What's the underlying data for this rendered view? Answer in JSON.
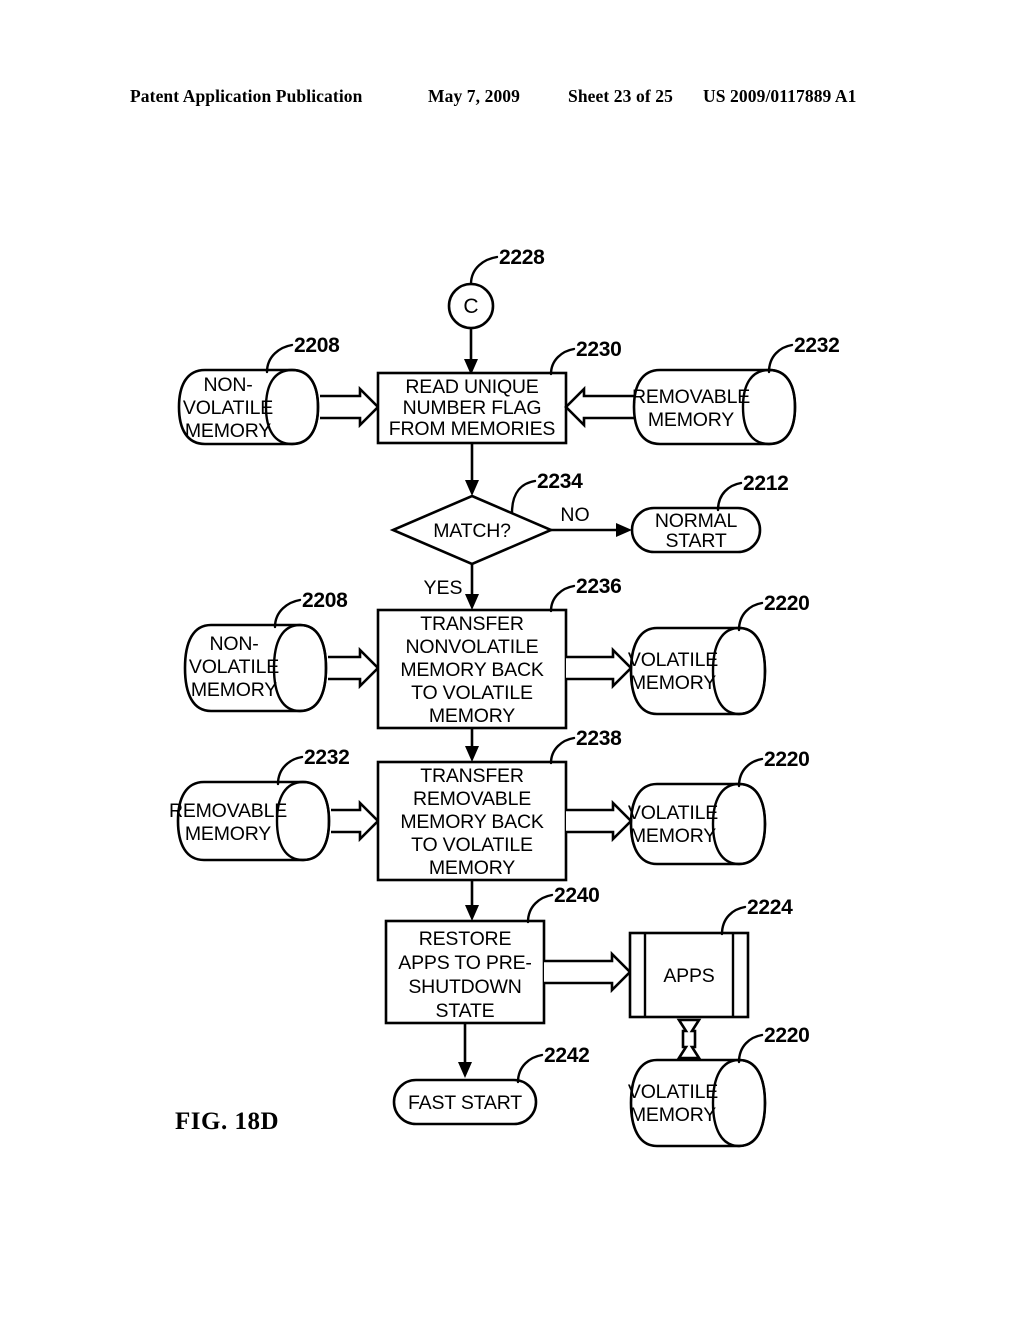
{
  "header": {
    "publication": "Patent Application Publication",
    "date": "May 7, 2009",
    "sheet": "Sheet 23 of 25",
    "patent_number": "US 2009/0117889 A1"
  },
  "figure": {
    "label": "FIG. 18D",
    "connector": {
      "letter": "C",
      "ref": "2228"
    },
    "nodes": {
      "nonvolatile_memory_top": {
        "type": "cylinder",
        "lines": [
          "NON-",
          "VOLATILE",
          "MEMORY"
        ],
        "ref": "2208"
      },
      "read_unique_number_flag": {
        "type": "process",
        "lines": [
          "READ UNIQUE",
          "NUMBER FLAG",
          "FROM MEMORIES"
        ],
        "ref": "2230"
      },
      "removable_memory_top": {
        "type": "cylinder",
        "lines": [
          "REMOVABLE",
          "MEMORY"
        ],
        "ref": "2232"
      },
      "match_decision": {
        "type": "decision",
        "lines": [
          "MATCH?"
        ],
        "ref": "2234",
        "branch_no": "NO",
        "branch_yes": "YES"
      },
      "normal_start": {
        "type": "terminator",
        "lines": [
          "NORMAL",
          "START"
        ],
        "ref": "2212"
      },
      "nonvolatile_memory_mid": {
        "type": "cylinder",
        "lines": [
          "NON-",
          "VOLATILE",
          "MEMORY"
        ],
        "ref": "2208"
      },
      "transfer_nonvolatile": {
        "type": "process",
        "lines": [
          "TRANSFER",
          "NONVOLATILE",
          "MEMORY BACK",
          "TO VOLATILE",
          "MEMORY"
        ],
        "ref": "2236"
      },
      "volatile_memory_row2": {
        "type": "cylinder",
        "lines": [
          "VOLATILE",
          "MEMORY"
        ],
        "ref": "2220"
      },
      "removable_memory_mid": {
        "type": "cylinder",
        "lines": [
          "REMOVABLE",
          "MEMORY"
        ],
        "ref": "2232"
      },
      "transfer_removable": {
        "type": "process",
        "lines": [
          "TRANSFER",
          "REMOVABLE",
          "MEMORY BACK",
          "TO VOLATILE",
          "MEMORY"
        ],
        "ref": "2238"
      },
      "volatile_memory_row3": {
        "type": "cylinder",
        "lines": [
          "VOLATILE",
          "MEMORY"
        ],
        "ref": "2220"
      },
      "restore_apps": {
        "type": "process",
        "lines": [
          "RESTORE",
          "APPS TO PRE-",
          "SHUTDOWN",
          "STATE"
        ],
        "ref": "2240"
      },
      "apps": {
        "type": "predefined-process",
        "lines": [
          "APPS"
        ],
        "ref": "2224"
      },
      "fast_start": {
        "type": "terminator",
        "lines": [
          "FAST START"
        ],
        "ref": "2242"
      },
      "volatile_memory_bottom": {
        "type": "cylinder",
        "lines": [
          "VOLATILE",
          "MEMORY"
        ],
        "ref": "2220"
      }
    }
  }
}
